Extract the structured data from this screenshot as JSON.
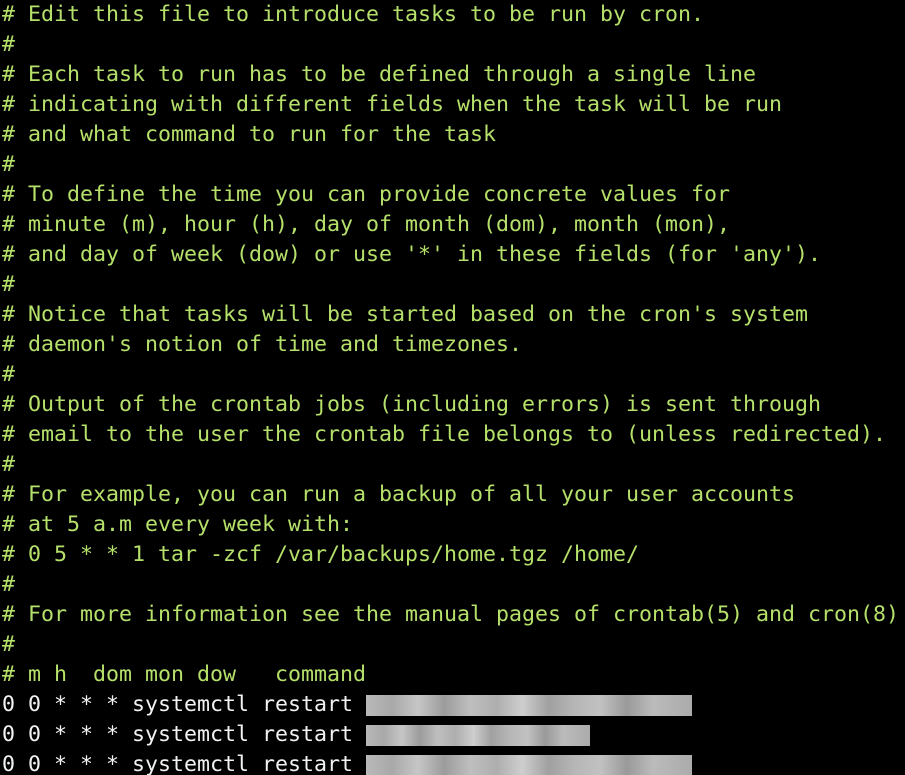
{
  "comment_lines": [
    "# Edit this file to introduce tasks to be run by cron.",
    "#",
    "# Each task to run has to be defined through a single line",
    "# indicating with different fields when the task will be run",
    "# and what command to run for the task",
    "#",
    "# To define the time you can provide concrete values for",
    "# minute (m), hour (h), day of month (dom), month (mon),",
    "# and day of week (dow) or use '*' in these fields (for 'any').",
    "#",
    "# Notice that tasks will be started based on the cron's system",
    "# daemon's notion of time and timezones.",
    "#",
    "# Output of the crontab jobs (including errors) is sent through",
    "# email to the user the crontab file belongs to (unless redirected).",
    "#",
    "# For example, you can run a backup of all your user accounts",
    "# at 5 a.m every week with:",
    "# 0 5 * * 1 tar -zcf /var/backups/home.tgz /home/",
    "#",
    "# For more information see the manual pages of crontab(5) and cron(8)",
    "#",
    "# m h  dom mon dow   command"
  ],
  "cron_entries": [
    "0 0 * * * systemctl restart",
    "0 0 * * * systemctl restart",
    "0 0 * * * systemctl restart"
  ],
  "colors": {
    "background": "#000000",
    "comment": "#b5e06a",
    "entry": "#f2f2f2"
  }
}
